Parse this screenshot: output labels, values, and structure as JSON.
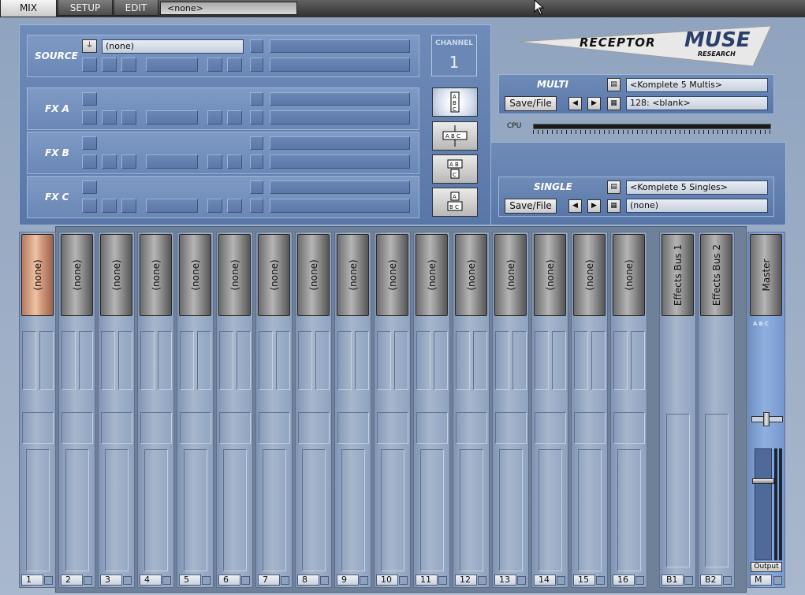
{
  "tabs": {
    "mix": "MIX",
    "setup": "SETUP",
    "edit": "EDIT",
    "preset": "<none>"
  },
  "source": {
    "label": "SOURCE",
    "value": "(none)",
    "rows": [
      {
        "label": "FX A"
      },
      {
        "label": "FX B"
      },
      {
        "label": "FX C"
      }
    ]
  },
  "channel": {
    "label": "CHANNEL",
    "number": "1"
  },
  "logo": {
    "brand": "RECEPTOR",
    "product": "MUSE",
    "sub": "RESEARCH"
  },
  "multi": {
    "label": "MULTI",
    "bank": "<Komplete 5 Multis>",
    "preset": "128: <blank>",
    "save": "Save/File"
  },
  "cpu": {
    "label": "CPU"
  },
  "single": {
    "label": "SINGLE",
    "bank": "<Komplete 5 Singles>",
    "preset": "(none)",
    "save": "Save/File"
  },
  "mixer": {
    "channels": [
      {
        "name": "(none)",
        "num": "1"
      },
      {
        "name": "(none)",
        "num": "2"
      },
      {
        "name": "(none)",
        "num": "3"
      },
      {
        "name": "(none)",
        "num": "4"
      },
      {
        "name": "(none)",
        "num": "5"
      },
      {
        "name": "(none)",
        "num": "6"
      },
      {
        "name": "(none)",
        "num": "7"
      },
      {
        "name": "(none)",
        "num": "8"
      },
      {
        "name": "(none)",
        "num": "9"
      },
      {
        "name": "(none)",
        "num": "10"
      },
      {
        "name": "(none)",
        "num": "11"
      },
      {
        "name": "(none)",
        "num": "12"
      },
      {
        "name": "(none)",
        "num": "13"
      },
      {
        "name": "(none)",
        "num": "14"
      },
      {
        "name": "(none)",
        "num": "15"
      },
      {
        "name": "(none)",
        "num": "16"
      }
    ],
    "buses": [
      {
        "name": "Effects Bus 1",
        "num": "B1"
      },
      {
        "name": "Effects Bus 2",
        "num": "B2"
      }
    ],
    "master": {
      "name": "Master",
      "num": "M",
      "output": "Output",
      "abc": "ABC"
    }
  },
  "colors": {
    "selected_channel": "#d9a283",
    "panel": "#6482b2"
  }
}
